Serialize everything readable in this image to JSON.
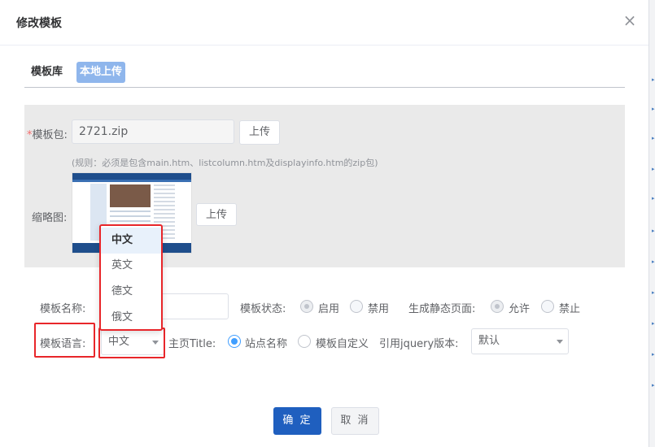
{
  "dialog": {
    "title": "修改模板",
    "close_icon": "×"
  },
  "tabs": {
    "library": "模板库",
    "local_upload": "本地上传"
  },
  "upload": {
    "package_label": "模板包:",
    "required_mark": "*",
    "package_value": "2721.zip",
    "upload_button": "上传",
    "rule_hint": "(规则：必须是包含main.htm、listcolumn.htm及displayinfo.htm的zip包)",
    "thumbnail_label": "缩略图:",
    "thumbnail_upload_button": "上传"
  },
  "form": {
    "name_label": "模板名称:",
    "status_label": "模板状态:",
    "status_options": [
      "启用",
      "禁用"
    ],
    "static_label": "生成静态页面:",
    "static_options": [
      "允许",
      "禁止"
    ],
    "language_label": "模板语言:",
    "language_selected": "中文",
    "homepage_title_label": "主页Title:",
    "homepage_title_options": [
      "站点名称",
      "模板自定义"
    ],
    "jquery_label": "引用jquery版本:",
    "jquery_selected": "默认"
  },
  "language_dropdown": {
    "options": [
      "中文",
      "英文",
      "德文",
      "俄文"
    ],
    "selected_index": 0
  },
  "footer": {
    "confirm": "确 定",
    "cancel": "取 消"
  },
  "colors": {
    "primary": "#1f5fbf",
    "highlight_box": "#e8262a",
    "tab_active": "#8fb6ec",
    "radio_checked": "#409eff"
  }
}
